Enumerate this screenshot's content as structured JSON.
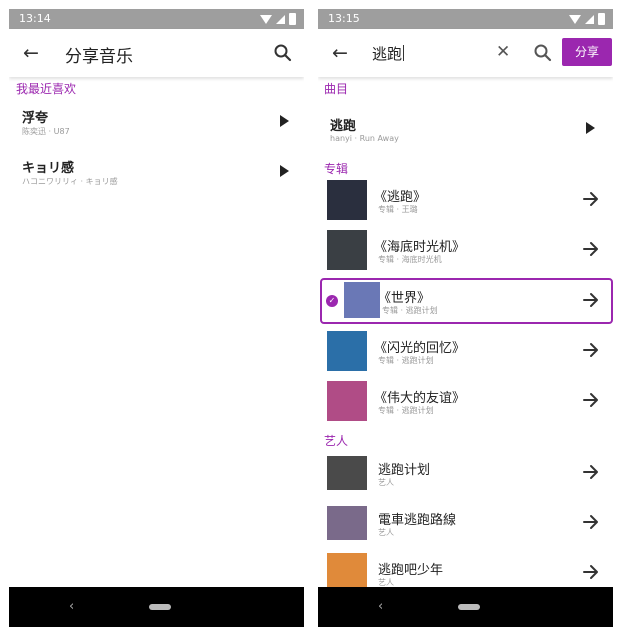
{
  "left": {
    "status_time": "13:14",
    "title": "分享音乐",
    "section": "我最近喜欢",
    "songs": [
      {
        "title": "浮夸",
        "sub": "陈奕迅 · U87"
      },
      {
        "title": "キョリ感",
        "sub": "ハコニワリリィ · キョリ感"
      }
    ]
  },
  "right": {
    "status_time": "13:15",
    "query": "逃跑",
    "share_label": "分享",
    "sections": {
      "tracks": "曲目",
      "albums": "专辑",
      "artists": "艺人"
    },
    "track": {
      "title": "逃跑",
      "sub": "hanyi · Run Away"
    },
    "albums": [
      {
        "title": "《逃跑》",
        "sub": "专辑 · 王璐",
        "color": "#2a2f3e"
      },
      {
        "title": "《海底时光机》",
        "sub": "专辑 · 海底时光机",
        "color": "#3a3f44"
      },
      {
        "title": "《世界》",
        "sub": "专辑 · 逃跑计划",
        "color": "#6a78b6",
        "selected": true
      },
      {
        "title": "《闪光的回忆》",
        "sub": "专辑 · 逃跑计划",
        "color": "#2b6fa8"
      },
      {
        "title": "《伟大的友谊》",
        "sub": "专辑 · 逃跑计划",
        "color": "#b04c86"
      }
    ],
    "artists": [
      {
        "title": "逃跑计划",
        "sub": "艺人",
        "color": "#4a4a4a"
      },
      {
        "title": "電車逃跑路線",
        "sub": "艺人",
        "color": "#7a6a8a"
      },
      {
        "title": "逃跑吧少年",
        "sub": "艺人",
        "color": "#e08a3a"
      }
    ]
  },
  "colors": {
    "accent": "#9b27af",
    "status_bar": "#9e9e9e"
  }
}
